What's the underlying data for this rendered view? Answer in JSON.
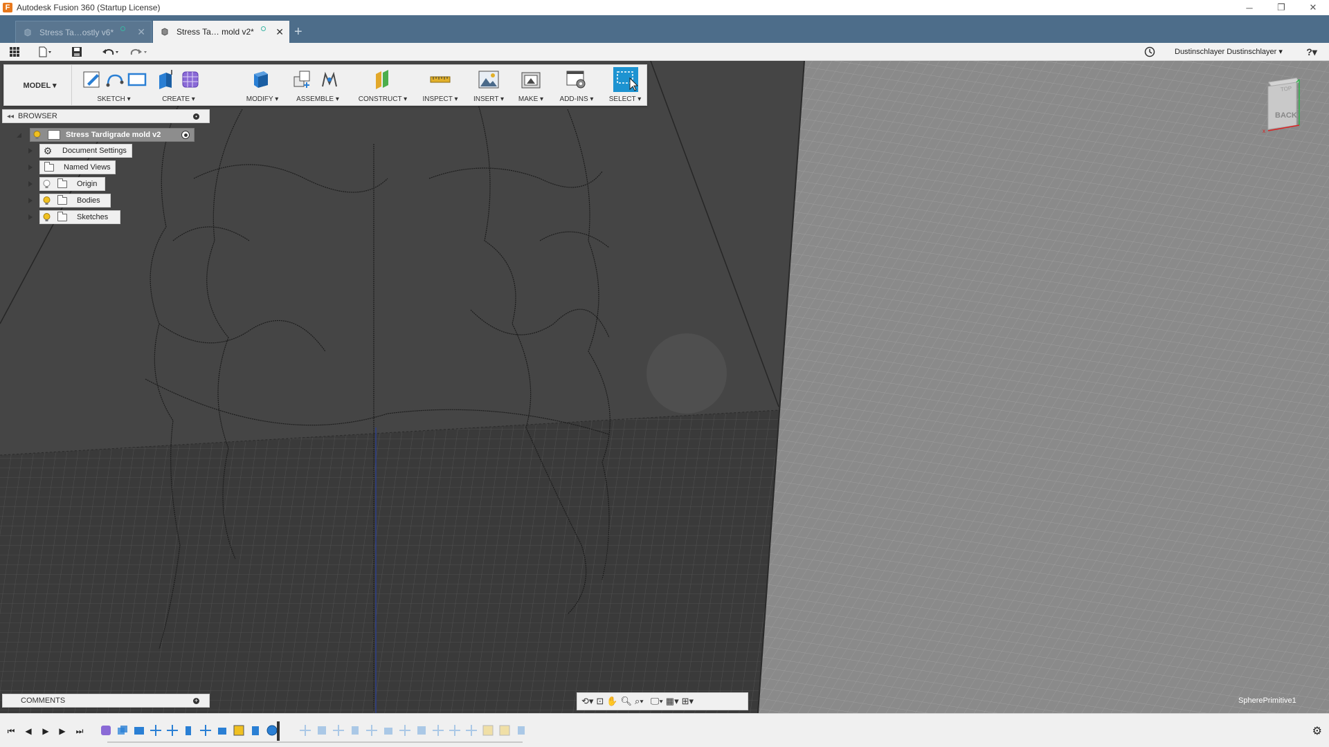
{
  "window": {
    "title": "Autodesk Fusion 360 (Startup License)",
    "app_icon": "F",
    "controls": {
      "minimize": "─",
      "restore": "❐",
      "close": "✕"
    }
  },
  "tabs": [
    {
      "label": "Stress Ta…ostly v6*",
      "active": false,
      "icon": "document-icon"
    },
    {
      "label": "Stress Ta… mold v2*",
      "active": true,
      "icon": "document-icon"
    }
  ],
  "new_tab": "+",
  "quick_access": {
    "user_label": "Dustinschlayer Dustinschlayer ▾",
    "help": "?▾",
    "icons": [
      "data-panel-icon",
      "file-icon",
      "save-icon",
      "undo-icon",
      "redo-icon",
      "job-status-icon"
    ]
  },
  "toolbar": {
    "workspace": "MODEL ▾",
    "groups": [
      {
        "label": "SKETCH ▾"
      },
      {
        "label": "CREATE ▾"
      },
      {
        "label": "MODIFY ▾"
      },
      {
        "label": "ASSEMBLE ▾"
      },
      {
        "label": "CONSTRUCT ▾"
      },
      {
        "label": "INSPECT ▾"
      },
      {
        "label": "INSERT ▾"
      },
      {
        "label": "MAKE ▾"
      },
      {
        "label": "ADD-INS ▾"
      },
      {
        "label": "SELECT ▾"
      }
    ]
  },
  "browser": {
    "header": "BROWSER",
    "root": "Stress Tardigrade mold v2",
    "items": [
      {
        "label": "Document Settings",
        "icon": "gear-icon"
      },
      {
        "label": "Named Views",
        "icon": "folder-icon"
      },
      {
        "label": "Origin",
        "icon": "folder-icon"
      },
      {
        "label": "Bodies",
        "icon": "folder-icon"
      },
      {
        "label": "Sketches",
        "icon": "folder-icon"
      }
    ]
  },
  "comments": {
    "label": "COMMENTS"
  },
  "viewcube": {
    "face": "BACK",
    "top": "TOP"
  },
  "status": {
    "selection": "SpherePrimitive1"
  },
  "colors": {
    "tabbar": "#4d6d8a",
    "selection_highlight": "#1d93d1",
    "viewport_bg": "#8a8a8a",
    "ground_dark": "#3a3a3a",
    "plane": "#484848"
  }
}
